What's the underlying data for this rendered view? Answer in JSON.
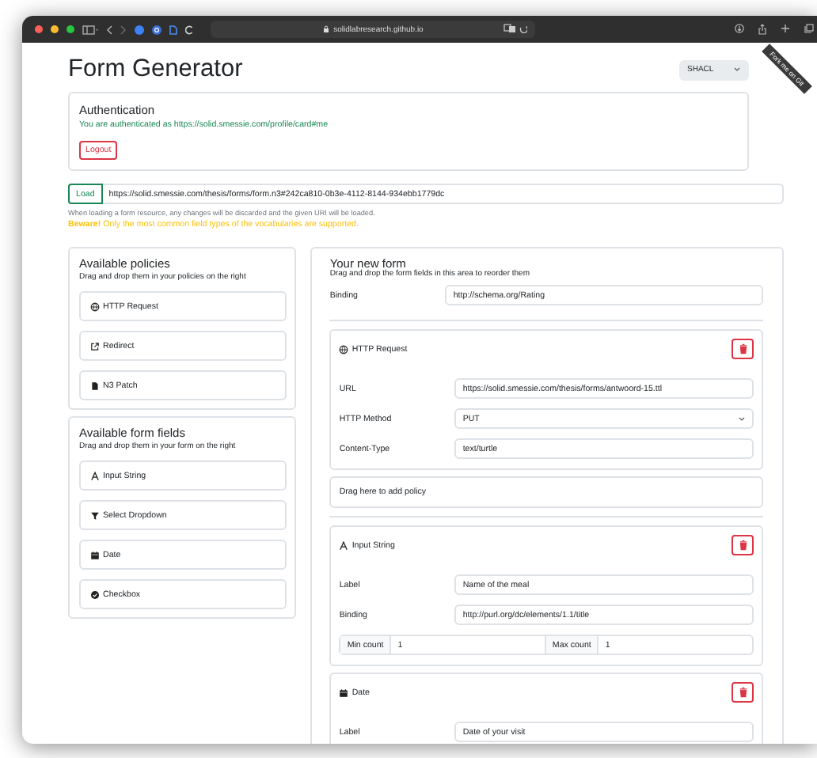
{
  "browser": {
    "address": "solidlabresearch.github.io"
  },
  "ribbon": {
    "text": "Fork me on Git"
  },
  "header": {
    "title": "Form Generator",
    "language": "SHACL"
  },
  "auth": {
    "title": "Authentication",
    "message": "You are authenticated as https://solid.smessie.com/profile/card#me",
    "logout": "Logout"
  },
  "load": {
    "button": "Load",
    "value": "https://solid.smessie.com/thesis/forms/form.n3#242ca810-0b3e-4112-8144-934ebb1779dc",
    "help": "When loading a form resource, any changes will be discarded and the given URI will be loaded.",
    "warning": "**Beware!** Only the most common field types of the vocabularies are supported."
  },
  "policies": {
    "title": "Available policies",
    "subtitle": "Drag and drop them in your policies on the right",
    "items": [
      {
        "kind": "globe",
        "label": "HTTP Request"
      },
      {
        "kind": "external",
        "label": "Redirect"
      },
      {
        "kind": "file",
        "label": "N3 Patch"
      }
    ]
  },
  "fields": {
    "title": "Available form fields",
    "subtitle": "Drag and drop them in your form on the right",
    "items": [
      {
        "kind": "letter",
        "label": "Input String"
      },
      {
        "kind": "funnel",
        "label": "Select Dropdown"
      },
      {
        "kind": "calendar",
        "label": "Date"
      },
      {
        "kind": "check",
        "label": "Checkbox"
      }
    ]
  },
  "form": {
    "title": "Your new form",
    "subtitle": "Drag and drop the form fields in this area to reorder them",
    "binding": {
      "label": "Binding",
      "value": "http://schema.org/Rating"
    },
    "entries": [
      {
        "kind": "request",
        "title": "HTTP Request",
        "rows": [
          {
            "kind": "input",
            "label": "URL",
            "value": "https://solid.smessie.com/thesis/forms/antwoord-15.ttl"
          },
          {
            "kind": "select",
            "label": "HTTP Method",
            "value": "PUT"
          },
          {
            "kind": "input",
            "label": "Content-Type",
            "value": "text/turtle"
          }
        ]
      },
      {
        "kind": "dropzone",
        "text": "Drag here to add policy"
      },
      {
        "kind": "divider"
      },
      {
        "kind": "string",
        "title": "Input String",
        "rows": [
          {
            "kind": "input",
            "label": "Label",
            "value": "Name of the meal"
          },
          {
            "kind": "input",
            "label": "Binding",
            "value": "http://purl.org/dc/elements/1.1/title"
          },
          {
            "kind": "counts",
            "min_label": "Min count",
            "min": "1",
            "max_label": "Max count",
            "max": "1"
          }
        ]
      },
      {
        "kind": "date",
        "title": "Date",
        "rows": [
          {
            "kind": "input",
            "label": "Label",
            "value": "Date of your visit"
          }
        ]
      }
    ]
  }
}
